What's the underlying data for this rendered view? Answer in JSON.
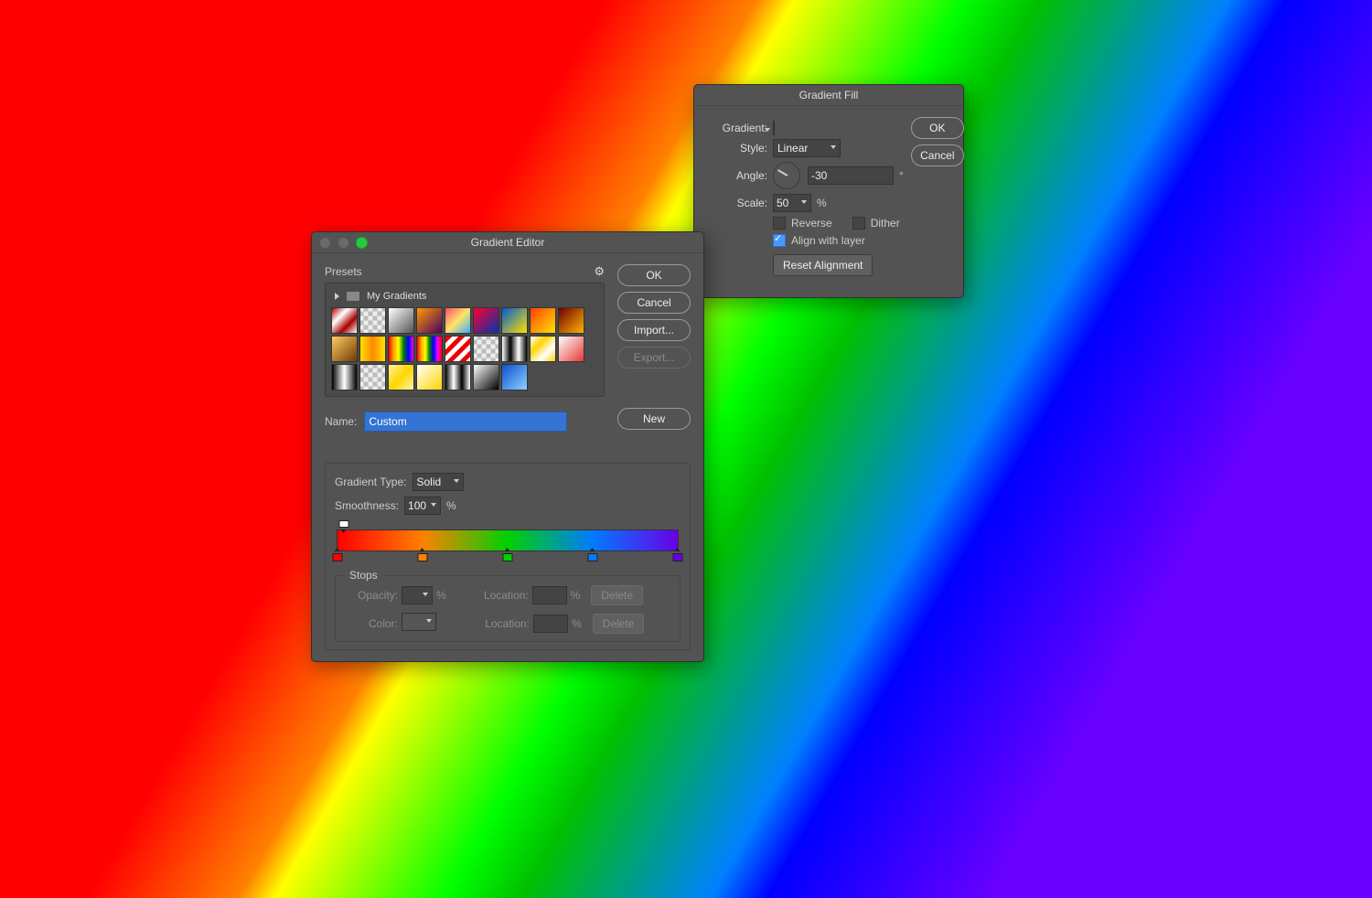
{
  "fill": {
    "title": "Gradient Fill",
    "gradient_label": "Gradient:",
    "style_label": "Style:",
    "style_value": "Linear",
    "angle_label": "Angle:",
    "angle_value": "-30",
    "angle_unit": "°",
    "scale_label": "Scale:",
    "scale_value": "50",
    "scale_unit": "%",
    "reverse_label": "Reverse",
    "dither_label": "Dither",
    "reverse_checked": false,
    "dither_checked": false,
    "align_label": "Align with layer",
    "align_checked": true,
    "reset_btn": "Reset Alignment",
    "ok": "OK",
    "cancel": "Cancel"
  },
  "editor": {
    "title": "Gradient Editor",
    "presets_label": "Presets",
    "folder_name": "My Gradients",
    "ok": "OK",
    "cancel": "Cancel",
    "import": "Import...",
    "export": "Export...",
    "new": "New",
    "name_label": "Name:",
    "name_value": "Custom",
    "type_label": "Gradient Type:",
    "type_value": "Solid",
    "smooth_label": "Smoothness:",
    "smooth_value": "100",
    "smooth_unit": "%",
    "stops_label": "Stops",
    "opacity_label": "Opacity:",
    "opacity_unit": "%",
    "location_label": "Location:",
    "location_unit": "%",
    "delete_label": "Delete",
    "color_label": "Color:",
    "color_stops": [
      {
        "pos": 0,
        "color": "#ff0000"
      },
      {
        "pos": 25,
        "color": "#ff8000"
      },
      {
        "pos": 50,
        "color": "#00d000"
      },
      {
        "pos": 75,
        "color": "#007bff"
      },
      {
        "pos": 100,
        "color": "#6a00e6"
      }
    ],
    "opacity_stops": [
      {
        "pos": 0
      }
    ]
  }
}
